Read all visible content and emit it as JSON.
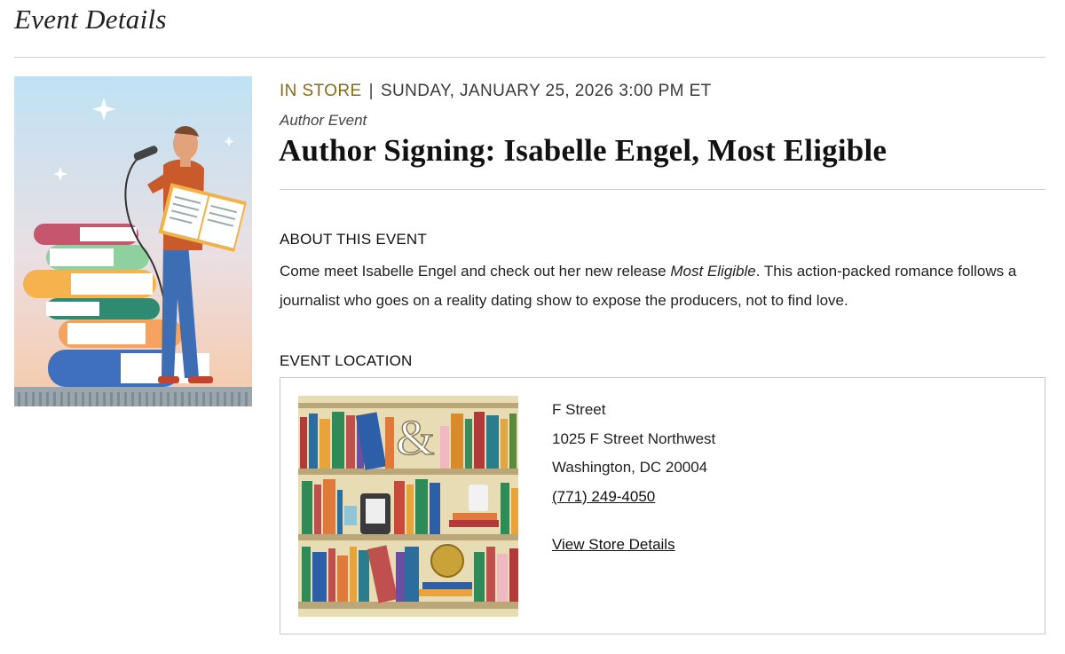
{
  "page": {
    "title": "Event Details"
  },
  "event": {
    "venue_type": "In Store",
    "separator": "|",
    "datetime": "Sunday, January 25, 2026 3:00 PM ET",
    "category": "Author Event",
    "title": "Author Signing: Isabelle Engel, Most Eligible",
    "about_heading": "About This Event",
    "about_text_before": "Come meet Isabelle Engel and check out her new release ",
    "about_text_italic": "Most Eligible",
    "about_text_after": ". This action-packed romance follows a journalist who goes on a reality dating show to expose the producers, not to find love.",
    "location_heading": "Event Location"
  },
  "location": {
    "store_name": "F Street",
    "street": "1025 F Street Northwest",
    "city_state_zip": "Washington, DC 20004",
    "phone": "(771) 249-4050",
    "details_link": "View Store Details",
    "logo_symbol": "&"
  },
  "colors": {
    "venue_type": "#8a6a12",
    "rule": "#cfcfcf",
    "shelf": "#e8dcb4"
  }
}
